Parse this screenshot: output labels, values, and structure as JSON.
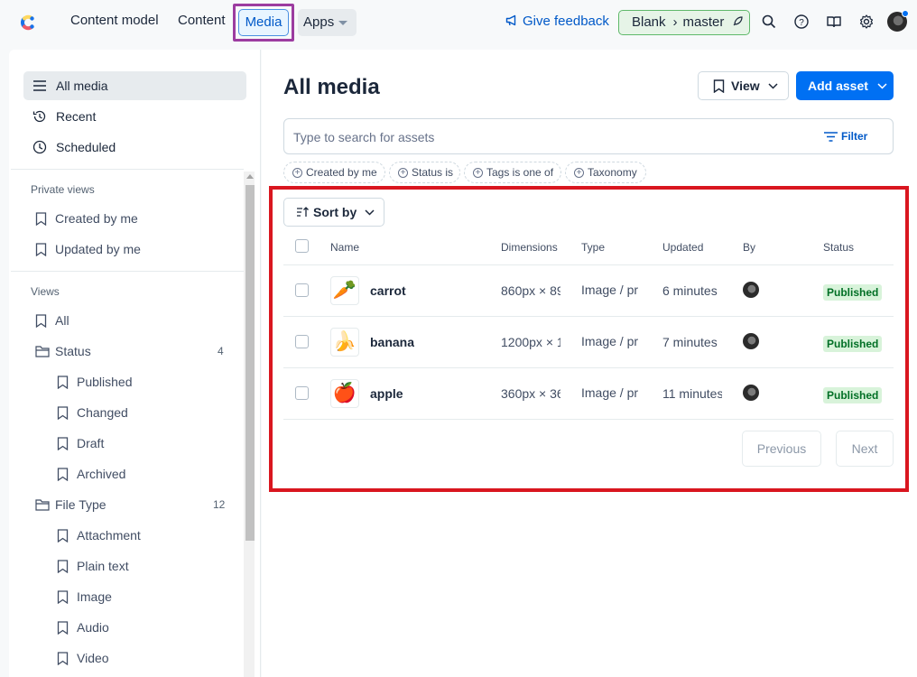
{
  "topbar": {
    "nav": [
      "Content model",
      "Content",
      "Media",
      "Apps"
    ],
    "feedback": "Give feedback",
    "env": {
      "space": "Blank",
      "branch": "master"
    },
    "icons": [
      "search-icon",
      "help-icon",
      "docs-icon",
      "settings-icon"
    ]
  },
  "sidebar": {
    "top_items": [
      "All media",
      "Recent",
      "Scheduled"
    ],
    "private_views_title": "Private views",
    "private_views": [
      "Created by me",
      "Updated by me"
    ],
    "views_title": "Views",
    "all": "All",
    "status_folder": {
      "label": "Status",
      "count": "4"
    },
    "status_items": [
      "Published",
      "Changed",
      "Draft",
      "Archived"
    ],
    "filetype_folder": {
      "label": "File Type",
      "count": "12"
    },
    "filetype_items": [
      "Attachment",
      "Plain text",
      "Image",
      "Audio",
      "Video"
    ]
  },
  "main": {
    "title": "All media",
    "view_label": "View",
    "add_label": "Add asset",
    "search_placeholder": "Type to search for assets",
    "filter_label": "Filter",
    "chips": [
      "Created by me",
      "Status is",
      "Tags is one of",
      "Taxonomy"
    ],
    "sort_label": "Sort by",
    "columns": [
      "Name",
      "Dimensions",
      "Type",
      "Updated",
      "By",
      "Status"
    ],
    "rows": [
      {
        "emoji": "🥕",
        "name": "carrot",
        "dimensions": "860px × 89",
        "type": "Image / pr",
        "updated": "6 minutes",
        "status": "Published"
      },
      {
        "emoji": "🍌",
        "name": "banana",
        "dimensions": "1200px × 1",
        "type": "Image / pr",
        "updated": "7 minutes",
        "status": "Published"
      },
      {
        "emoji": "🍎",
        "name": "apple",
        "dimensions": "360px × 36",
        "type": "Image / pr",
        "updated": "11 minutes",
        "status": "Published"
      }
    ],
    "prev_label": "Previous",
    "next_label": "Next"
  },
  "colors": {
    "accent": "#0070f3",
    "highlight_media": "#9c3ca0",
    "red_highlight": "#d9161f",
    "published": "#006f25"
  }
}
